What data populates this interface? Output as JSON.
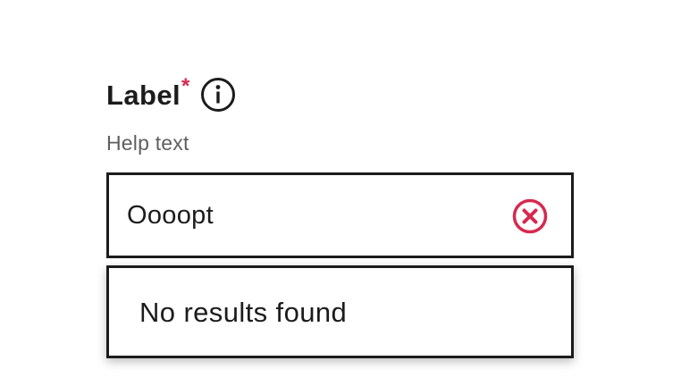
{
  "field": {
    "label": "Label",
    "required_marker": "*",
    "help_text": "Help text",
    "info_icon": "info-icon"
  },
  "input": {
    "value": "Oooopt",
    "clear_icon": "close-circle-icon"
  },
  "dropdown": {
    "empty_message": "No results found"
  },
  "colors": {
    "text": "#1c1c1c",
    "help_text": "#5f5f5f",
    "required": "#d7294f",
    "clear_icon": "#d7294f",
    "border": "#1c1c1c"
  }
}
